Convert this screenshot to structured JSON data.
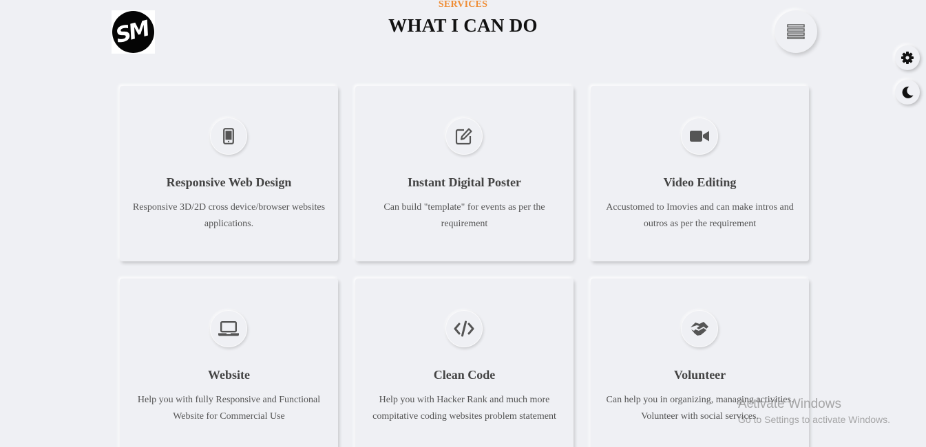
{
  "brand": {
    "logo_text": "SM"
  },
  "header": {
    "subtitle": "SERVICES",
    "title": "WHAT I CAN DO"
  },
  "controls": {
    "menu_icon": "hamburger-icon",
    "settings_icon": "gear-icon",
    "theme_icon": "moon-icon"
  },
  "colors": {
    "accent": "#ef8d35",
    "background": "#eff0f4",
    "text": "#444444",
    "icon": "#555555"
  },
  "services": [
    {
      "icon": "mobile-icon",
      "title": "Responsive Web Design",
      "description": "Responsive 3D/2D cross device/browser websites applications."
    },
    {
      "icon": "edit-icon",
      "title": "Instant Digital Poster",
      "description": "Can build \"template\" for events as per the requirement"
    },
    {
      "icon": "video-camera-icon",
      "title": "Video Editing",
      "description": "Accustomed to Imovies and can make intros and outros as per the requirement"
    },
    {
      "icon": "laptop-icon",
      "title": "Website",
      "description": "Help you with fully Responsive and Functional Website for Commercial Use"
    },
    {
      "icon": "code-icon",
      "title": "Clean Code",
      "description": "Help you with Hacker Rank and much more compitative coding websites problem statement"
    },
    {
      "icon": "handshake-icon",
      "title": "Volunteer",
      "description": "Can help you in organizing, managing activities. Volunteer with social services."
    }
  ],
  "watermark": {
    "title": "Activate Windows",
    "subtitle": "Go to Settings to activate Windows."
  }
}
